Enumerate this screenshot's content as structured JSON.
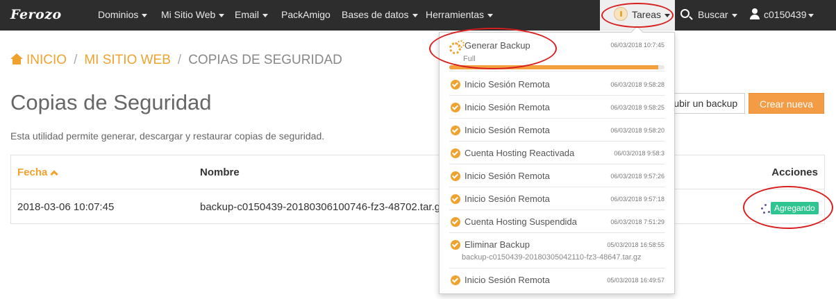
{
  "nav": {
    "logo": "Ferozo",
    "items": [
      "Dominios",
      "Mi Sitio Web",
      "Email",
      "PackAmigo",
      "Bases de datos",
      "Herramientas"
    ],
    "tareas": "Tareas",
    "buscar": "Buscar",
    "user": "c0150439"
  },
  "breadcrumb": {
    "home": "INICIO",
    "section": "MI SITIO WEB",
    "current": "COPIAS DE SEGURIDAD"
  },
  "page": {
    "title": "Copias de Seguridad",
    "description": "Esta utilidad permite generar, descargar y restaurar copias de seguridad.",
    "btn_subir": "Subir un backup",
    "btn_crear": "Crear nueva"
  },
  "table": {
    "headers": {
      "fecha": "Fecha",
      "nombre": "Nombre",
      "acciones": "Acciones"
    },
    "rows": [
      {
        "fecha": "2018-03-06 10:07:45",
        "nombre": "backup-c0150439-20180306100746-fz3-48702.tar.gz",
        "estado": "Agregando"
      }
    ]
  },
  "tasks": {
    "current": {
      "title": "Generar Backup",
      "timestamp": "06/03/2018 10:7:45",
      "subtitle": "Full",
      "progress": 0.97
    },
    "items": [
      {
        "title": "Inicio Sesión Remota",
        "timestamp": "06/03/2018 9:58:28"
      },
      {
        "title": "Inicio Sesión Remota",
        "timestamp": "06/03/2018 9:58:25"
      },
      {
        "title": "Inicio Sesión Remota",
        "timestamp": "06/03/2018 9:58:20"
      },
      {
        "title": "Cuenta Hosting Reactivada",
        "timestamp": "06/03/2018 9:58:3"
      },
      {
        "title": "Inicio Sesión Remota",
        "timestamp": "06/03/2018 9:57:26"
      },
      {
        "title": "Inicio Sesión Remota",
        "timestamp": "06/03/2018 9:57:18"
      },
      {
        "title": "Cuenta Hosting Suspendida",
        "timestamp": "06/03/2018 7:51:29"
      },
      {
        "title": "Eliminar Backup",
        "timestamp": "05/03/2018 16:58:55",
        "subtitle": "backup-c0150439-20180305042110-fz3-48647.tar.gz"
      },
      {
        "title": "Inicio Sesión Remota",
        "timestamp": "05/03/2018 16:49:57"
      }
    ]
  },
  "colors": {
    "accent": "#f0a22e",
    "nav_bg": "#2d2d2d",
    "badge": "#2ec590",
    "annotation": "#d81e1e"
  }
}
